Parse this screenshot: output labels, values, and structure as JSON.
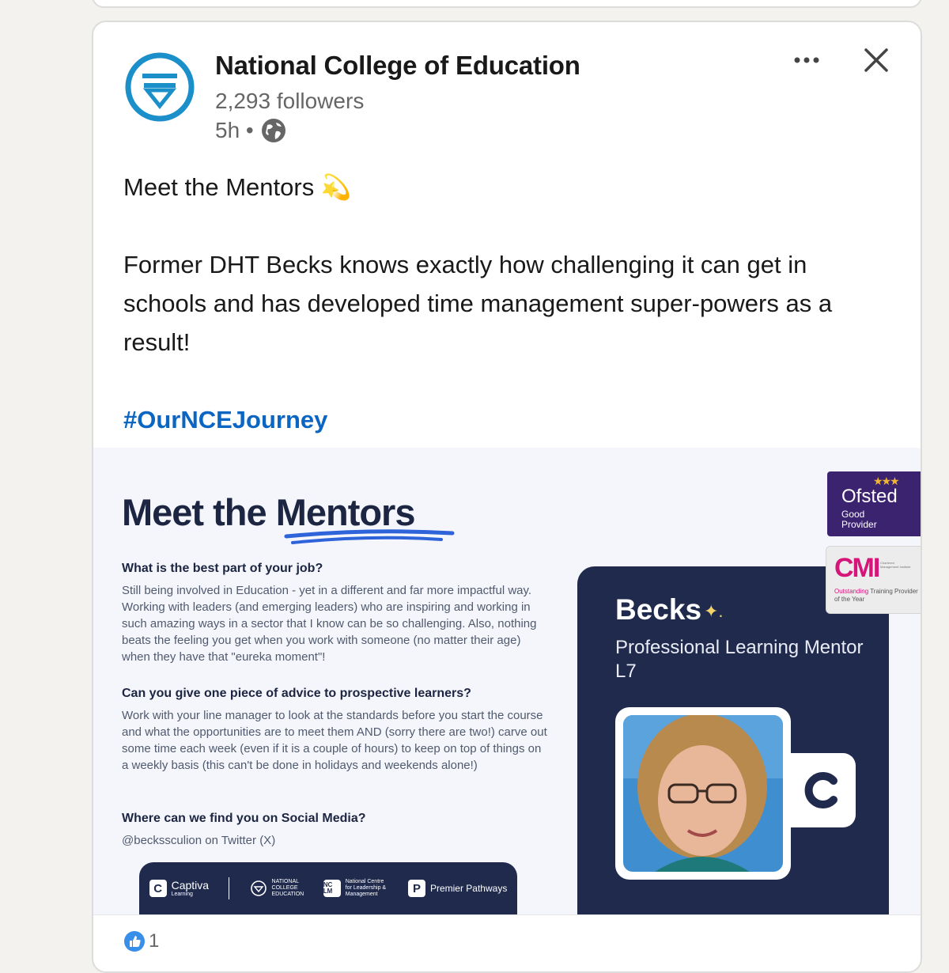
{
  "post": {
    "author": "National College of Education",
    "followers": "2,293 followers",
    "time": "5h •",
    "text_title": "Meet the Mentors",
    "title_emoji": "💫",
    "text_body": "Former DHT Becks knows exactly how challenging it can get in schools and has developed time management super-powers as a result!",
    "hashtag": "#OurNCEJourney",
    "reaction_count": "1"
  },
  "creative": {
    "title": "Meet the Mentors",
    "q1": "What is the best part of your job?",
    "a1": "Still being involved in Education - yet in a different and far more impactful way. Working with leaders (and emerging leaders) who are inspiring and working in such amazing ways in a sector that I know can be so challenging. Also, nothing beats the feeling you get when you work with someone (no matter their age) when they have that \"eureka moment\"!",
    "q2": "Can you give one piece of advice to prospective learners?",
    "a2": "Work with your line manager to look at the standards before you start the course and what the opportunities are to meet them AND (sorry there are two!) carve out some time each week (even if it is a couple of hours) to keep on top of things on a weekly basis (this can't be done in holidays and weekends alone!)",
    "q3": "Where can we find you on Social Media?",
    "a3": "@beckssculion on Twitter (X)",
    "mentor_name": "Becks",
    "mentor_sparkle": "✦.",
    "mentor_role": "Professional Learning Mentor L7",
    "ofsted_word": "Ofsted",
    "ofsted_sub": "Good Provider",
    "ofsted_stars": "★★★",
    "cmi_logo": "CMI",
    "cmi_tiny": "Chartered Management Institute",
    "cmi_award_pink": "Outstanding",
    "cmi_award_rest": "Training Provider of the Year",
    "footer": {
      "captiva": "Captiva",
      "captiva_sub": "Learning",
      "nce": "NATIONAL COLLEGE EDUCATION",
      "nclm_mark": "NC LM",
      "nclm": "National Centre for Leadership & Management",
      "premier": "Premier Pathways"
    }
  },
  "colors": {
    "brand_navy": "#1f2a4d",
    "logo_blue": "#1a8fc9",
    "hashtag_blue": "#0a66c2",
    "underline_blue": "#2e63d9",
    "ofsted_purple": "#3b2370",
    "cmi_pink": "#d6157a"
  },
  "icons": [
    "nce-logo-icon",
    "more-icon",
    "close-icon",
    "globe-icon",
    "like-icon"
  ]
}
